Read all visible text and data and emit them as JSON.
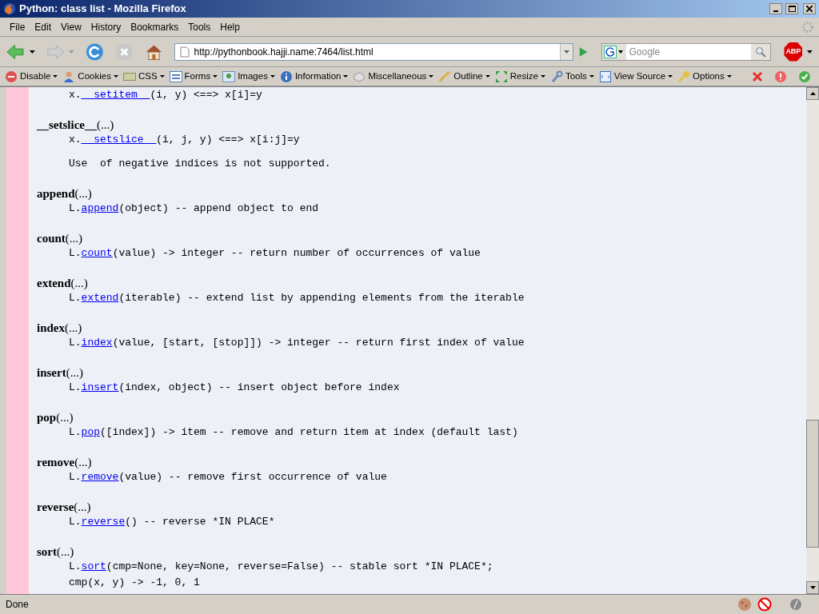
{
  "window": {
    "title": "Python: class list - Mozilla Firefox"
  },
  "menu": [
    "File",
    "Edit",
    "View",
    "History",
    "Bookmarks",
    "Tools",
    "Help"
  ],
  "navigation": {
    "url": "http://pythonbook.hajji.name:7464/list.html",
    "search_placeholder": "Google",
    "adblock_label": "ABP"
  },
  "toolbar": [
    {
      "label": "Disable",
      "kind": "disable"
    },
    {
      "label": "Cookies",
      "kind": "cookies"
    },
    {
      "label": "CSS",
      "kind": "css"
    },
    {
      "label": "Forms",
      "kind": "forms"
    },
    {
      "label": "Images",
      "kind": "images"
    },
    {
      "label": "Information",
      "kind": "information"
    },
    {
      "label": "Miscellaneous",
      "kind": "misc"
    },
    {
      "label": "Outline",
      "kind": "outline"
    },
    {
      "label": "Resize",
      "kind": "resize"
    },
    {
      "label": "Tools",
      "kind": "tools"
    },
    {
      "label": "View Source",
      "kind": "source"
    },
    {
      "label": "Options",
      "kind": "options"
    }
  ],
  "entries": [
    {
      "lines": [
        {
          "kind": "code",
          "prefix": "x.",
          "link": "__setitem__",
          "suffix": "(i, y) <==> x[i]=y"
        }
      ]
    },
    {
      "name": "__setslice__",
      "args": "(...)",
      "lines": [
        {
          "kind": "code",
          "prefix": "x.",
          "link": "__setslice__",
          "suffix": "(i, j, y) <==> x[i:j]=y"
        },
        {
          "kind": "note",
          "text": "Use  of negative indices is not supported."
        }
      ]
    },
    {
      "name": "append",
      "args": "(...)",
      "lines": [
        {
          "kind": "code",
          "prefix": "L.",
          "link": "append",
          "suffix": "(object) -- append object to end"
        }
      ]
    },
    {
      "name": "count",
      "args": "(...)",
      "lines": [
        {
          "kind": "code",
          "prefix": "L.",
          "link": "count",
          "suffix": "(value) -> integer -- return number of occurrences of value"
        }
      ]
    },
    {
      "name": "extend",
      "args": "(...)",
      "lines": [
        {
          "kind": "code",
          "prefix": "L.",
          "link": "extend",
          "suffix": "(iterable) -- extend list by appending elements from the iterable"
        }
      ]
    },
    {
      "name": "index",
      "args": "(...)",
      "lines": [
        {
          "kind": "code",
          "prefix": "L.",
          "link": "index",
          "suffix": "(value, [start, [stop]]) -> integer -- return first index of value"
        }
      ]
    },
    {
      "name": "insert",
      "args": "(...)",
      "lines": [
        {
          "kind": "code",
          "prefix": "L.",
          "link": "insert",
          "suffix": "(index, object) -- insert object before index"
        }
      ]
    },
    {
      "name": "pop",
      "args": "(...)",
      "lines": [
        {
          "kind": "code",
          "prefix": "L.",
          "link": "pop",
          "suffix": "([index]) -> item -- remove and return item at index (default last)"
        }
      ]
    },
    {
      "name": "remove",
      "args": "(...)",
      "lines": [
        {
          "kind": "code",
          "prefix": "L.",
          "link": "remove",
          "suffix": "(value) -- remove first occurrence of value"
        }
      ]
    },
    {
      "name": "reverse",
      "args": "(...)",
      "lines": [
        {
          "kind": "code",
          "prefix": "L.",
          "link": "reverse",
          "suffix": "() -- reverse *IN PLACE*"
        }
      ]
    },
    {
      "name": "sort",
      "args": "(...)",
      "lines": [
        {
          "kind": "code",
          "prefix": "L.",
          "link": "sort",
          "suffix": "(cmp=None, key=None, reverse=False) -- stable sort *IN PLACE*;"
        },
        {
          "kind": "note",
          "text": "cmp(x, y) -> -1, 0, 1"
        }
      ]
    }
  ],
  "status_bar": {
    "text": "Done"
  }
}
